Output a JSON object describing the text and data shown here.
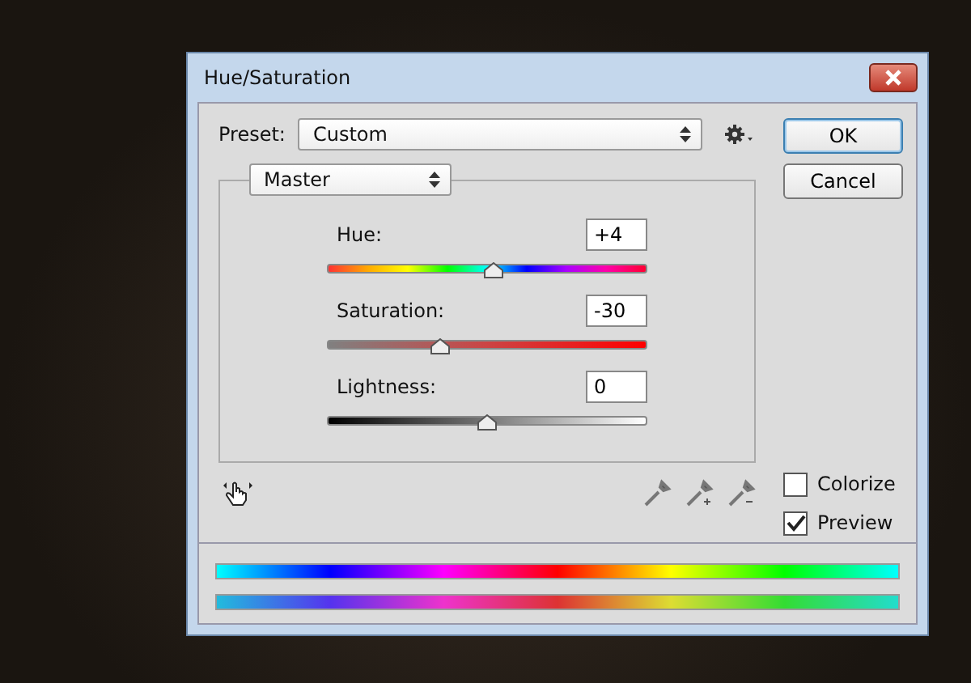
{
  "window": {
    "title": "Hue/Saturation"
  },
  "preset": {
    "label": "Preset:",
    "value": "Custom"
  },
  "buttons": [
    "OK",
    "Cancel"
  ],
  "channel": {
    "value": "Master"
  },
  "sliders": [
    {
      "kind": "hue",
      "label": "Hue:",
      "value": "+4",
      "level": 0.52
    },
    {
      "kind": "saturation",
      "label": "Saturation:",
      "value": "-30",
      "level": 0.35
    },
    {
      "kind": "lightness",
      "label": "Lightness:",
      "value": "0",
      "level": 0.5
    }
  ],
  "options": [
    {
      "label": "Colorize",
      "checked": false
    },
    {
      "label": "Preview",
      "checked": true
    }
  ]
}
